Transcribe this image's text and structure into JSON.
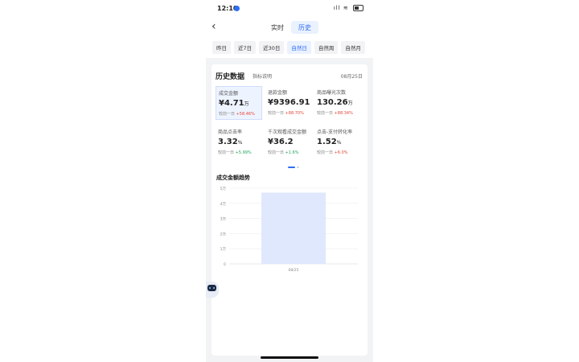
{
  "status_bar": {
    "time": "12:10",
    "signal": "ıll",
    "wifi": "≋"
  },
  "nav": {
    "back_icon": "chevron-left-icon",
    "segments": [
      {
        "label": "实时",
        "active": false
      },
      {
        "label": "历史",
        "active": true
      }
    ]
  },
  "period_tabs": [
    {
      "label": "昨日",
      "active": false
    },
    {
      "label": "近7日",
      "active": false
    },
    {
      "label": "近30日",
      "active": false
    },
    {
      "label": "自然日",
      "active": true
    },
    {
      "label": "自然周",
      "active": false
    },
    {
      "label": "自然月",
      "active": false
    }
  ],
  "card": {
    "title": "历史数据",
    "subtitle": "指标说明",
    "date": "08月25日",
    "metrics": [
      {
        "label": "成交金额",
        "value": "¥4.71",
        "unit": "万",
        "compare": "较前一日",
        "change": "+58.46%",
        "dir": "up",
        "selected": true
      },
      {
        "label": "退款金额",
        "value": "¥9396.91",
        "unit": "",
        "compare": "较前一日",
        "change": "+88.70%",
        "dir": "up",
        "selected": false
      },
      {
        "label": "商品曝光次数",
        "value": "130.26",
        "unit": "万",
        "compare": "较前一日",
        "change": "+88.34%",
        "dir": "up",
        "selected": false
      },
      {
        "label": "商品点击率",
        "value": "3.32",
        "unit": "%",
        "compare": "较前一日",
        "change": "+5.99%",
        "dir": "down",
        "selected": false
      },
      {
        "label": "千次观看成交金额",
        "value": "¥36.2",
        "unit": "",
        "compare": "较前一日",
        "change": "+1.6%",
        "dir": "down",
        "selected": false
      },
      {
        "label": "点击-支付转化率",
        "value": "1.52",
        "unit": "%",
        "compare": "较前一日",
        "change": "+6.0%",
        "dir": "up",
        "selected": false
      }
    ]
  },
  "chart_title": "成交金额趋势",
  "chart_data": {
    "type": "bar",
    "categories": [
      "08/25"
    ],
    "values": [
      4.71
    ],
    "yticks": [
      "5万",
      "4万",
      "3万",
      "2万",
      "1万",
      "0"
    ],
    "ylim": [
      0,
      5
    ],
    "grid": true,
    "bar_color": "#dfe8fd"
  },
  "colors": {
    "accent": "#2f6df6",
    "up": "#e5463b",
    "down": "#22a55a"
  }
}
